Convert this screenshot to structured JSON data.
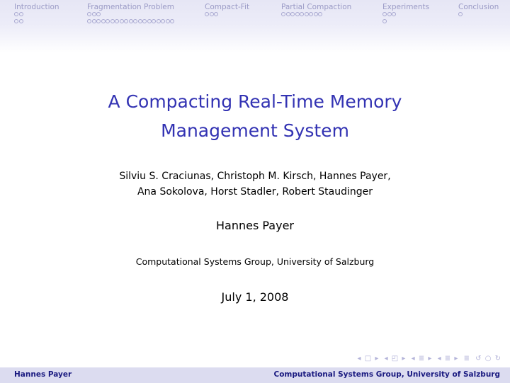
{
  "headline": {
    "sections": [
      {
        "label": "Introduction",
        "rows": [
          2,
          2
        ]
      },
      {
        "label": "Fragmentation Problem",
        "rows": [
          3,
          19
        ]
      },
      {
        "label": "Compact-Fit",
        "rows": [
          3
        ]
      },
      {
        "label": "Partial Compaction",
        "rows": [
          9
        ]
      },
      {
        "label": "Experiments",
        "rows": [
          3,
          1
        ]
      },
      {
        "label": "Conclusion",
        "rows": [
          1
        ]
      }
    ]
  },
  "slide": {
    "title_line1": "A Compacting Real-Time Memory",
    "title_line2": "Management System",
    "authors_line1": "Silviu S. Craciunas, Christoph M. Kirsch, Hannes Payer,",
    "authors_line2": "Ana Sokolova, Horst Stadler, Robert Staudinger",
    "presenter": "Hannes Payer",
    "institute": "Computational Systems Group, University of Salzburg",
    "date": "July 1, 2008"
  },
  "nav_symbols": {
    "frame": "◂ □ ▸",
    "subsection": "◂ ◰ ▸",
    "section": "◂ ≣ ▸",
    "doc": "◂ ≣ ▸",
    "align": "≣",
    "search": "↺ ○ ↻"
  },
  "footer": {
    "left": "Hannes Payer",
    "right": "Computational Systems Group, University of Salzburg"
  },
  "colors": {
    "title": "#3333b3",
    "headline_text": "#9b9bc6",
    "footer_bg": "#dcdcf0",
    "footer_text": "#1a1a80"
  }
}
